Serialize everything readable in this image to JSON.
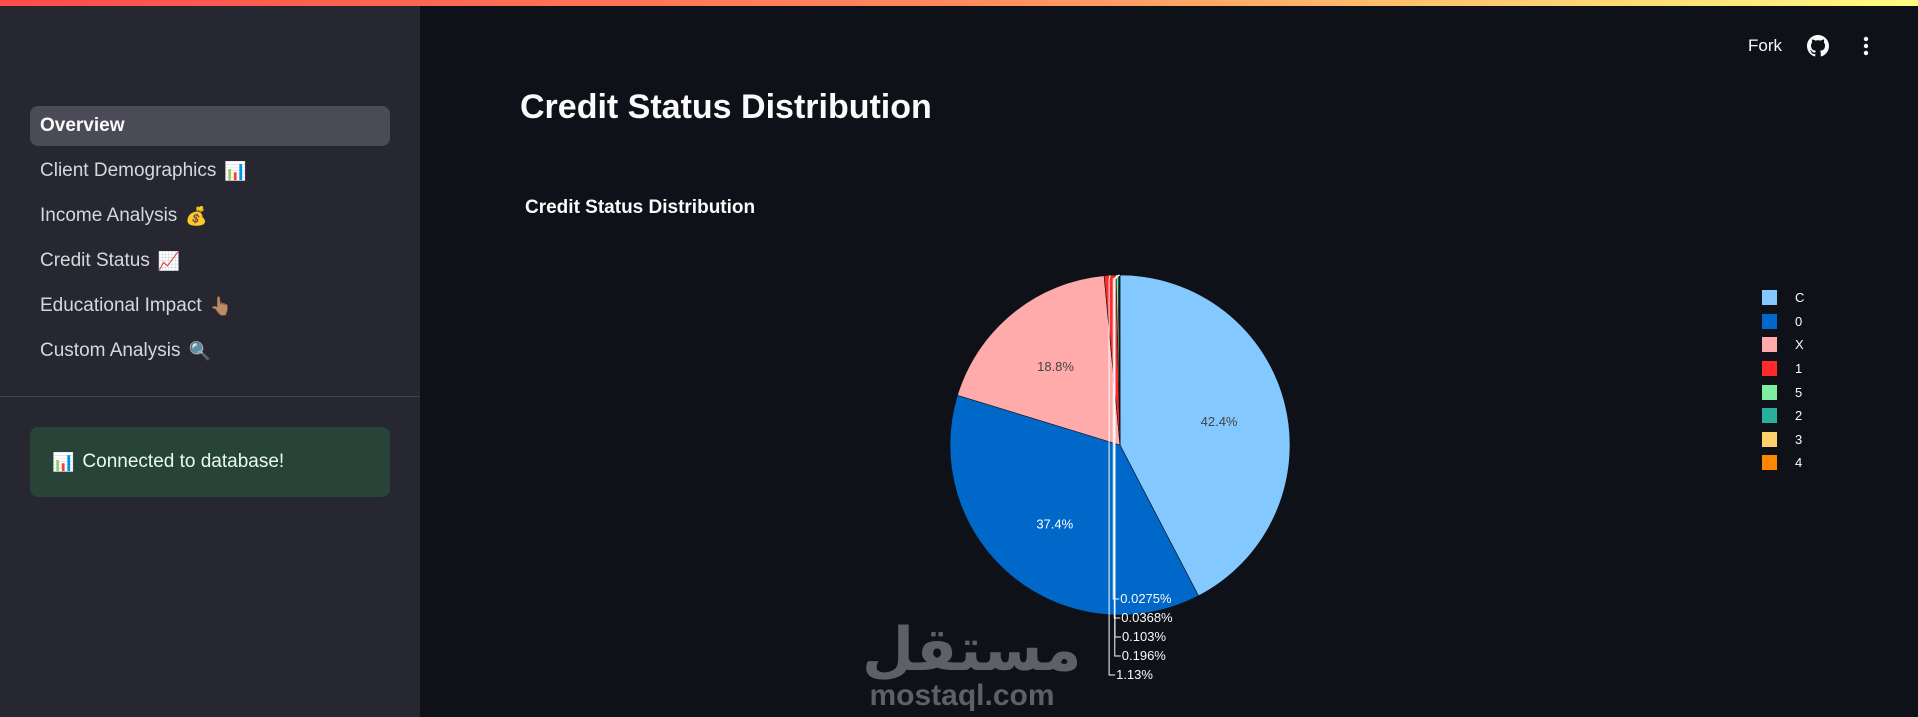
{
  "sidebar": {
    "nav": [
      {
        "label": "Overview",
        "emoji": "",
        "active": true
      },
      {
        "label": "Client Demographics",
        "emoji": "📊",
        "active": false
      },
      {
        "label": "Income Analysis",
        "emoji": "💰",
        "active": false
      },
      {
        "label": "Credit Status",
        "emoji": "📈",
        "active": false
      },
      {
        "label": "Educational Impact",
        "emoji": "👆🏽",
        "active": false
      },
      {
        "label": "Custom Analysis",
        "emoji": "🔍",
        "active": false
      }
    ],
    "status": {
      "emoji": "📊",
      "text": "Connected to database!"
    }
  },
  "toolbar": {
    "fork_label": "Fork",
    "github_icon": "github-icon",
    "menu_icon": "kebab-menu-icon"
  },
  "main": {
    "page_title": "Credit Status Distribution"
  },
  "watermark": {
    "arabic": "مستقل",
    "latin": "mostaql.com"
  },
  "chart_data": {
    "type": "pie",
    "title": "Credit Status Distribution",
    "slices": [
      {
        "label": "C",
        "percent": 42.4,
        "text": "42.4%",
        "color": "#83c9ff",
        "text_color": "#444444"
      },
      {
        "label": "0",
        "percent": 37.4,
        "text": "37.4%",
        "color": "#0068c9",
        "text_color": "#ffffff"
      },
      {
        "label": "X",
        "percent": 18.8,
        "text": "18.8%",
        "color": "#ffabab",
        "text_color": "#444444"
      },
      {
        "label": "1",
        "percent": 1.13,
        "text": "1.13%",
        "color": "#ff2b2b",
        "text_color": "#ffffff"
      },
      {
        "label": "5",
        "percent": 0.196,
        "text": "0.196%",
        "color": "#7defa1",
        "text_color": "#ffffff"
      },
      {
        "label": "2",
        "percent": 0.103,
        "text": "0.103%",
        "color": "#29b09d",
        "text_color": "#ffffff"
      },
      {
        "label": "3",
        "percent": 0.0368,
        "text": "0.0368%",
        "color": "#ffd16a",
        "text_color": "#ffffff"
      },
      {
        "label": "4",
        "percent": 0.0275,
        "text": "0.0275%",
        "color": "#ff8700",
        "text_color": "#ffffff"
      }
    ],
    "legend_order": [
      "C",
      "0",
      "X",
      "1",
      "5",
      "2",
      "3",
      "4"
    ],
    "legend_position": "right",
    "direction": "clockwise",
    "start_angle": "top"
  }
}
